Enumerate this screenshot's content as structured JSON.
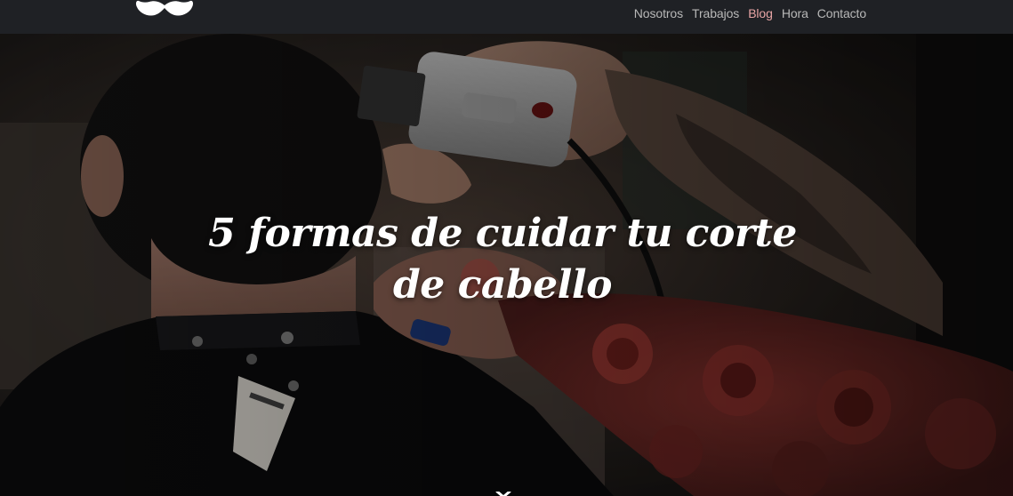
{
  "nav": {
    "logo_icon": "mustache-icon",
    "links": [
      {
        "label": "Nosotros"
      },
      {
        "label": "Trabajos"
      },
      {
        "label": "Blog"
      },
      {
        "label": "Hora"
      },
      {
        "label": "Contacto"
      }
    ],
    "active_index": 2
  },
  "hero": {
    "title": "5 formas de cuidar tu corte de cabello",
    "scroll_icon": "chevron-down-icon"
  },
  "colors": {
    "navbar_bg": "#1f2125",
    "nav_text": "#b8b8b8",
    "nav_active": "#e8a5a5",
    "title_text": "#ffffff"
  }
}
